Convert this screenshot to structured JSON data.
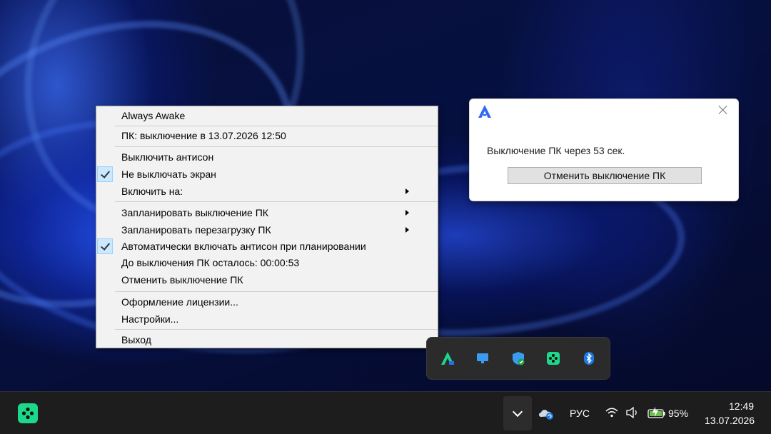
{
  "menu": {
    "items": [
      {
        "label": "Always Awake",
        "checked": false,
        "submenu": false
      },
      {
        "label": "ПК: выключение в 13.07.2026 12:50",
        "checked": false,
        "submenu": false
      },
      {
        "label": "Выключить антисон",
        "checked": false,
        "submenu": false
      },
      {
        "label": "Не выключать экран",
        "checked": true,
        "submenu": false
      },
      {
        "label": "Включить на:",
        "checked": false,
        "submenu": true
      },
      {
        "label": "Запланировать выключение ПК",
        "checked": false,
        "submenu": true
      },
      {
        "label": "Запланировать перезагрузку ПК",
        "checked": false,
        "submenu": true
      },
      {
        "label": "Автоматически включать антисон при планировании",
        "checked": true,
        "submenu": false
      },
      {
        "label": "До выключения ПК осталось: 00:00:53",
        "checked": false,
        "submenu": false
      },
      {
        "label": "Отменить выключение ПК",
        "checked": false,
        "submenu": false
      },
      {
        "label": "Оформление лицензии...",
        "checked": false,
        "submenu": false
      },
      {
        "label": "Настройки...",
        "checked": false,
        "submenu": false
      },
      {
        "label": "Выход",
        "checked": false,
        "submenu": false
      }
    ]
  },
  "toast": {
    "message": "Выключение ПК через 53 сек.",
    "button": "Отменить выключение ПК"
  },
  "tray": {
    "flyout_icons": [
      "always-awake-icon",
      "display-icon",
      "security-shield-icon",
      "green-app-icon",
      "bluetooth-icon"
    ],
    "language": "РУС",
    "battery": "95%",
    "time": "12:49",
    "date": "13.07.2026"
  },
  "colors": {
    "brand_blue": "#2f6bf0",
    "app_green": "#1cd88a",
    "taskbar": "#1d1d1d"
  }
}
